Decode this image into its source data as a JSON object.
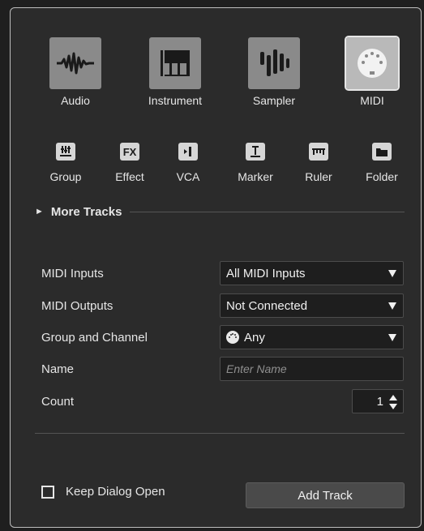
{
  "track_types_main": [
    {
      "label": "Audio",
      "icon": "audio-waveform-icon"
    },
    {
      "label": "Instrument",
      "icon": "piano-keys-icon"
    },
    {
      "label": "Sampler",
      "icon": "sampler-bars-icon"
    },
    {
      "label": "MIDI",
      "icon": "midi-connector-icon",
      "selected": true
    }
  ],
  "track_types_secondary": [
    {
      "label": "Group",
      "icon": "group-faders-icon"
    },
    {
      "label": "Effect",
      "icon": "fx-icon",
      "glyph": "FX"
    },
    {
      "label": "VCA",
      "icon": "vca-icon"
    },
    {
      "label": "Marker",
      "icon": "marker-icon"
    },
    {
      "label": "Ruler",
      "icon": "ruler-icon"
    },
    {
      "label": "Folder",
      "icon": "folder-icon"
    }
  ],
  "more_tracks": {
    "label": "More Tracks",
    "arrow": "►"
  },
  "fields": {
    "midi_inputs": {
      "label": "MIDI Inputs",
      "value": "All MIDI Inputs"
    },
    "midi_outputs": {
      "label": "MIDI Outputs",
      "value": "Not Connected"
    },
    "group_channel": {
      "label": "Group and Channel",
      "value": "Any"
    },
    "name": {
      "label": "Name",
      "placeholder": "Enter Name"
    },
    "count": {
      "label": "Count",
      "value": "1"
    }
  },
  "footer": {
    "keep_open_label": "Keep Dialog Open",
    "keep_open_checked": false,
    "add_track_label": "Add Track"
  }
}
